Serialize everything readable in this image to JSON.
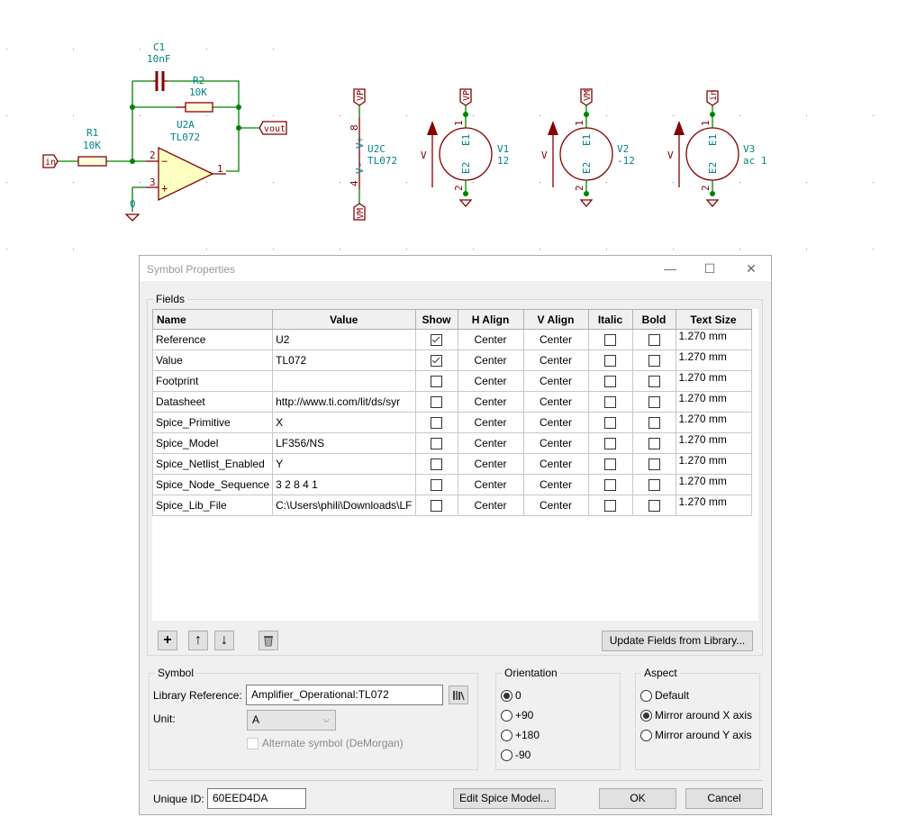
{
  "schematic": {
    "c1": {
      "ref": "C1",
      "value": "10nF"
    },
    "r2": {
      "ref": "R2",
      "value": "10K"
    },
    "r1": {
      "ref": "R1",
      "value": "10K"
    },
    "u2a": {
      "ref": "U2A",
      "value": "TL072"
    },
    "u2c": {
      "ref": "U2C",
      "value": "TL072",
      "pin_vp": "V+",
      "pin_vm": "V-",
      "pin8": "8",
      "pin4": "4"
    },
    "opamp_pins": {
      "inv": "2",
      "noninv": "3",
      "out": "1"
    },
    "ground_label": "0",
    "labels": {
      "in": "in",
      "vout": "vout",
      "vp": "VP",
      "vm": "VM"
    },
    "sources": [
      {
        "ref": "V1",
        "value": "12",
        "top_label": "VP"
      },
      {
        "ref": "V2",
        "value": "-12",
        "top_label": "VM"
      },
      {
        "ref": "V3",
        "value": "ac 1",
        "top_label": "in"
      }
    ],
    "source_pins": {
      "e1": "E1",
      "e2": "E2",
      "p1": "1",
      "p2": "2",
      "arrow": "V"
    }
  },
  "dialog": {
    "title": "Symbol Properties",
    "window_buttons": {
      "minimize": "—",
      "maximize": "☐",
      "close": "✕"
    },
    "fields_group": "Fields",
    "columns": [
      "Name",
      "Value",
      "Show",
      "H Align",
      "V Align",
      "Italic",
      "Bold",
      "Text Size"
    ],
    "rows": [
      {
        "name": "Reference",
        "value": "U2",
        "show": true,
        "halign": "Center",
        "valign": "Center",
        "italic": false,
        "bold": false,
        "size": "1.270 mm"
      },
      {
        "name": "Value",
        "value": "TL072",
        "show": true,
        "halign": "Center",
        "valign": "Center",
        "italic": false,
        "bold": false,
        "size": "1.270 mm"
      },
      {
        "name": "Footprint",
        "value": "",
        "show": false,
        "halign": "Center",
        "valign": "Center",
        "italic": false,
        "bold": false,
        "size": "1.270 mm"
      },
      {
        "name": "Datasheet",
        "value": "http://www.ti.com/lit/ds/syr",
        "show": false,
        "halign": "Center",
        "valign": "Center",
        "italic": false,
        "bold": false,
        "size": "1.270 mm"
      },
      {
        "name": "Spice_Primitive",
        "value": "X",
        "show": false,
        "halign": "Center",
        "valign": "Center",
        "italic": false,
        "bold": false,
        "size": "1.270 mm"
      },
      {
        "name": "Spice_Model",
        "value": "LF356/NS",
        "show": false,
        "halign": "Center",
        "valign": "Center",
        "italic": false,
        "bold": false,
        "size": "1.270 mm"
      },
      {
        "name": "Spice_Netlist_Enabled",
        "value": "Y",
        "show": false,
        "halign": "Center",
        "valign": "Center",
        "italic": false,
        "bold": false,
        "size": "1.270 mm"
      },
      {
        "name": "Spice_Node_Sequence",
        "value": "3 2 8 4 1",
        "show": false,
        "halign": "Center",
        "valign": "Center",
        "italic": false,
        "bold": false,
        "size": "1.270 mm"
      },
      {
        "name": "Spice_Lib_File",
        "value": "C:\\Users\\phili\\Downloads\\LF",
        "show": false,
        "halign": "Center",
        "valign": "Center",
        "italic": false,
        "bold": false,
        "size": "1.270 mm"
      }
    ],
    "toolbar": {
      "add": "+",
      "up": "↑",
      "down": "↓",
      "update_fields": "Update Fields from Library..."
    },
    "symbol": {
      "group": "Symbol",
      "lib_ref_label": "Library Reference:",
      "lib_ref_value": "Amplifier_Operational:TL072",
      "unit_label": "Unit:",
      "unit_value": "A",
      "alternate_label": "Alternate symbol (DeMorgan)"
    },
    "orientation": {
      "group": "Orientation",
      "options": [
        "0",
        "+90",
        "+180",
        "-90"
      ],
      "selected": "0"
    },
    "aspect": {
      "group": "Aspect",
      "options": [
        "Default",
        "Mirror around X axis",
        "Mirror around Y axis"
      ],
      "selected": "Mirror around X axis"
    },
    "footer": {
      "uid_label": "Unique ID:",
      "uid_value": "60EED4DA",
      "edit_spice": "Edit Spice Model...",
      "ok": "OK",
      "cancel": "Cancel"
    }
  }
}
